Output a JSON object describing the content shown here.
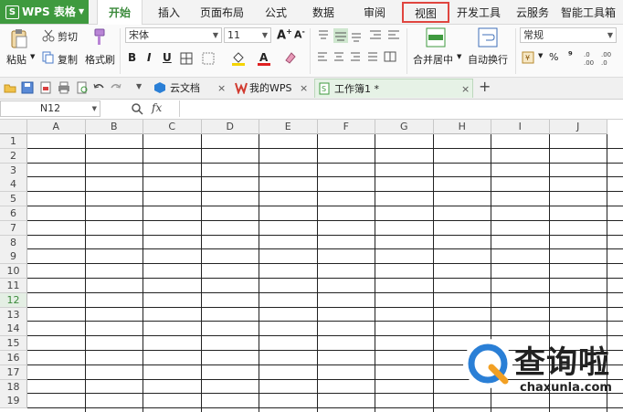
{
  "app": {
    "name": "WPS 表格",
    "logo_glyph": "S"
  },
  "menu": {
    "tabs": [
      "开始",
      "插入",
      "页面布局",
      "公式",
      "数据",
      "审阅",
      "视图",
      "开发工具",
      "云服务",
      "智能工具箱"
    ],
    "active": "开始",
    "highlighted": "视图"
  },
  "ribbon": {
    "paste": "粘贴",
    "cut": "剪切",
    "copy": "复制",
    "format_painter": "格式刷",
    "font_name": "宋体",
    "font_size": "11",
    "bold": "B",
    "italic": "I",
    "underline": "U",
    "merge_center": "合并居中",
    "wrap_text": "自动换行",
    "number_format": "常规",
    "percent": "%",
    "thousands": "⁹"
  },
  "quickbar": {
    "tabs": [
      {
        "label": "云文档"
      },
      {
        "label": "我的WPS"
      },
      {
        "label": "工作簿1 *"
      }
    ],
    "new_tab": "+",
    "close": "×"
  },
  "formula": {
    "namebox": "N12",
    "fx": "fx"
  },
  "sheet": {
    "columns": [
      "A",
      "B",
      "C",
      "D",
      "E",
      "F",
      "G",
      "H",
      "I",
      "J"
    ],
    "rows": [
      "1",
      "2",
      "3",
      "4",
      "5",
      "6",
      "7",
      "8",
      "9",
      "10",
      "11",
      "12",
      "13",
      "14",
      "15",
      "16",
      "17",
      "18",
      "19"
    ],
    "selected_row": "12"
  },
  "watermark": {
    "brand": "查询啦",
    "url": "chaxunla.com"
  },
  "colors": {
    "accent_green": "#3f9a3f",
    "highlight_red": "#e0453f",
    "wps_red": "#d13a2f",
    "brand_blue": "#2a7fd6"
  }
}
